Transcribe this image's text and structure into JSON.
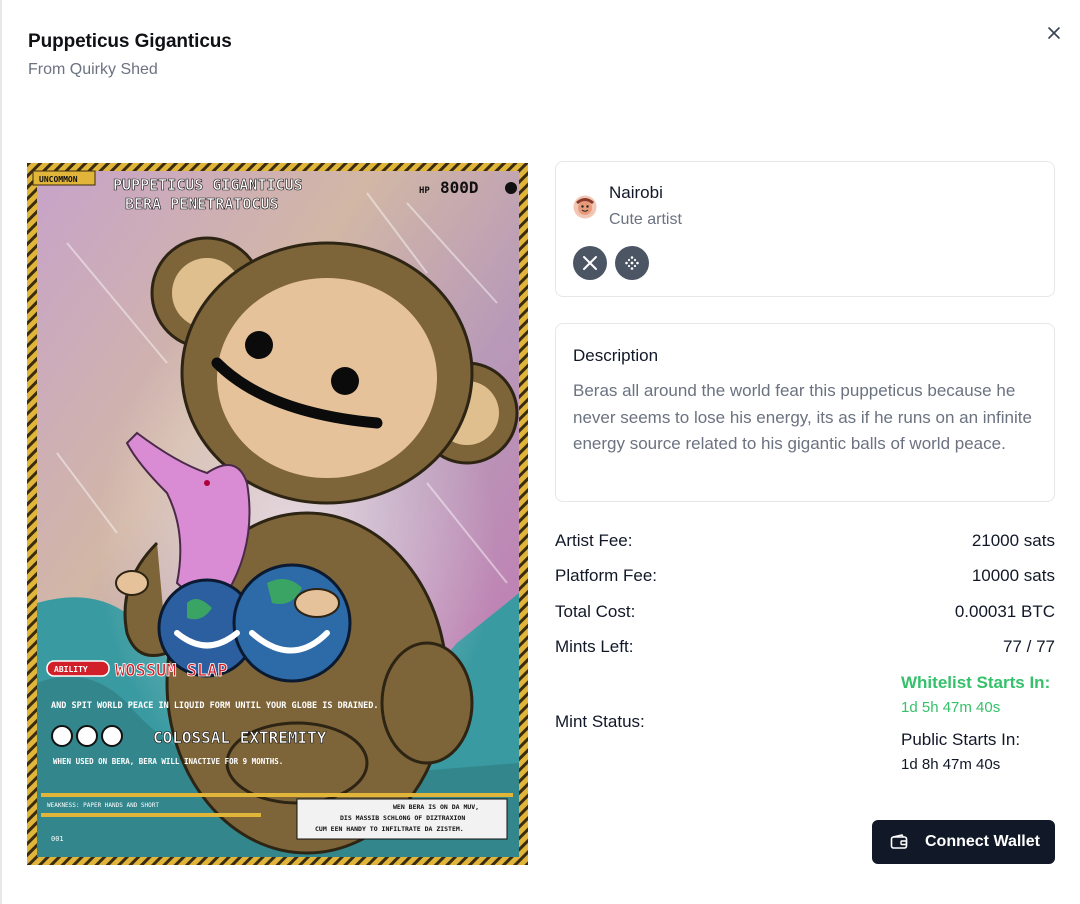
{
  "header": {
    "title": "Puppeticus Giganticus",
    "subtitle": "From Quirky Shed"
  },
  "card": {
    "rarity": "UNCOMMON",
    "name_line1": "PUPPETICUS GIGANTICUS",
    "name_line2": "BERA PENETRATOCUS",
    "hp_label": "HP",
    "hp_value": "800D",
    "ability_badge": "ABILITY",
    "ability_name": "WOSSUM SLAP",
    "ability_text": "AND SPIT WORLD PEACE IN LIQUID FORM UNTIL YOUR GLOBE IS DRAINED.",
    "attack_name": "COLOSSAL EXTREMITY",
    "attack_text": "WHEN USED ON BERA, BERA WILL INACTIVE FOR 9 MONTHS.",
    "weakness": "WEAKNESS: PAPER HANDS AND SHORT",
    "flavor_line1": "WEN BERA IS ON DA MUV,",
    "flavor_line2": "DIS MASSIB SCHLONG OF DIZTRAXION",
    "flavor_line3": "CUM EEN HANDY TO INFILTRATE DA ZISTEM.",
    "number": "001"
  },
  "artist": {
    "name": "Nairobi",
    "role": "Cute artist",
    "socials": [
      "x-icon",
      "link-icon"
    ]
  },
  "description": {
    "title": "Description",
    "text": "Beras all around the world fear this puppeticus because he never seems to lose his energy, its as if he runs on an infinite energy source related to his gigantic balls of world peace."
  },
  "fees": {
    "artist_fee_label": "Artist Fee:",
    "artist_fee_value": "21000 sats",
    "platform_fee_label": "Platform Fee:",
    "platform_fee_value": "10000 sats",
    "total_cost_label": "Total Cost:",
    "total_cost_value": "0.00031 BTC",
    "mints_left_label": "Mints Left:",
    "mints_left_value": "77 / 77"
  },
  "mint_status": {
    "label": "Mint Status:",
    "whitelist_label": "Whitelist Starts In:",
    "whitelist_time": "1d 5h 47m 40s",
    "public_label": "Public Starts In:",
    "public_time": "1d 8h 47m 40s"
  },
  "actions": {
    "connect_wallet": "Connect Wallet"
  },
  "colors": {
    "accent_green": "#35c06a",
    "button_dark": "#111827",
    "muted_text": "#6b7280"
  }
}
